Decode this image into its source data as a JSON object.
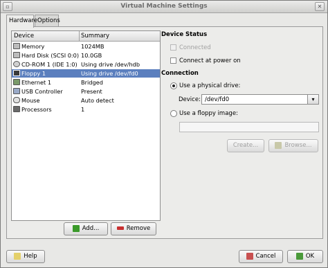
{
  "window": {
    "title": "Virtual Machine Settings"
  },
  "tabs": [
    {
      "label": "Hardware"
    },
    {
      "label": "Options"
    }
  ],
  "device_list": {
    "columns": [
      "Device",
      "Summary"
    ],
    "rows": [
      {
        "device": "Memory",
        "summary": "1024MB",
        "icon": "memory-icon"
      },
      {
        "device": "Hard Disk (SCSI 0:0)",
        "summary": "10.0GB",
        "icon": "hard-disk-icon"
      },
      {
        "device": "CD-ROM 1 (IDE 1:0)",
        "summary": "Using drive /dev/hdb",
        "icon": "cdrom-icon"
      },
      {
        "device": "Floppy 1",
        "summary": "Using drive /dev/fd0",
        "icon": "floppy-icon"
      },
      {
        "device": "Ethernet 1",
        "summary": "Bridged",
        "icon": "ethernet-icon"
      },
      {
        "device": "USB Controller",
        "summary": "Present",
        "icon": "usb-icon"
      },
      {
        "device": "Mouse",
        "summary": "Auto detect",
        "icon": "mouse-icon"
      },
      {
        "device": "Processors",
        "summary": "1",
        "icon": "processor-icon"
      }
    ]
  },
  "list_buttons": {
    "add": "Add...",
    "remove": "Remove"
  },
  "device_status": {
    "title": "Device Status",
    "connected": "Connected",
    "connect_at_power_on": "Connect at power on"
  },
  "connection": {
    "title": "Connection",
    "use_physical_drive": "Use a physical drive:",
    "device_label": "Device:",
    "device_value": "/dev/fd0",
    "use_floppy_image": "Use a floppy image:",
    "floppy_image_path": "",
    "create": "Create...",
    "browse": "Browse..."
  },
  "footer": {
    "help": "Help",
    "cancel": "Cancel",
    "ok": "OK"
  },
  "colors": {
    "selection": "#5b7fbe",
    "add_icon": "#3a9a2a",
    "remove_icon": "#c83030"
  }
}
